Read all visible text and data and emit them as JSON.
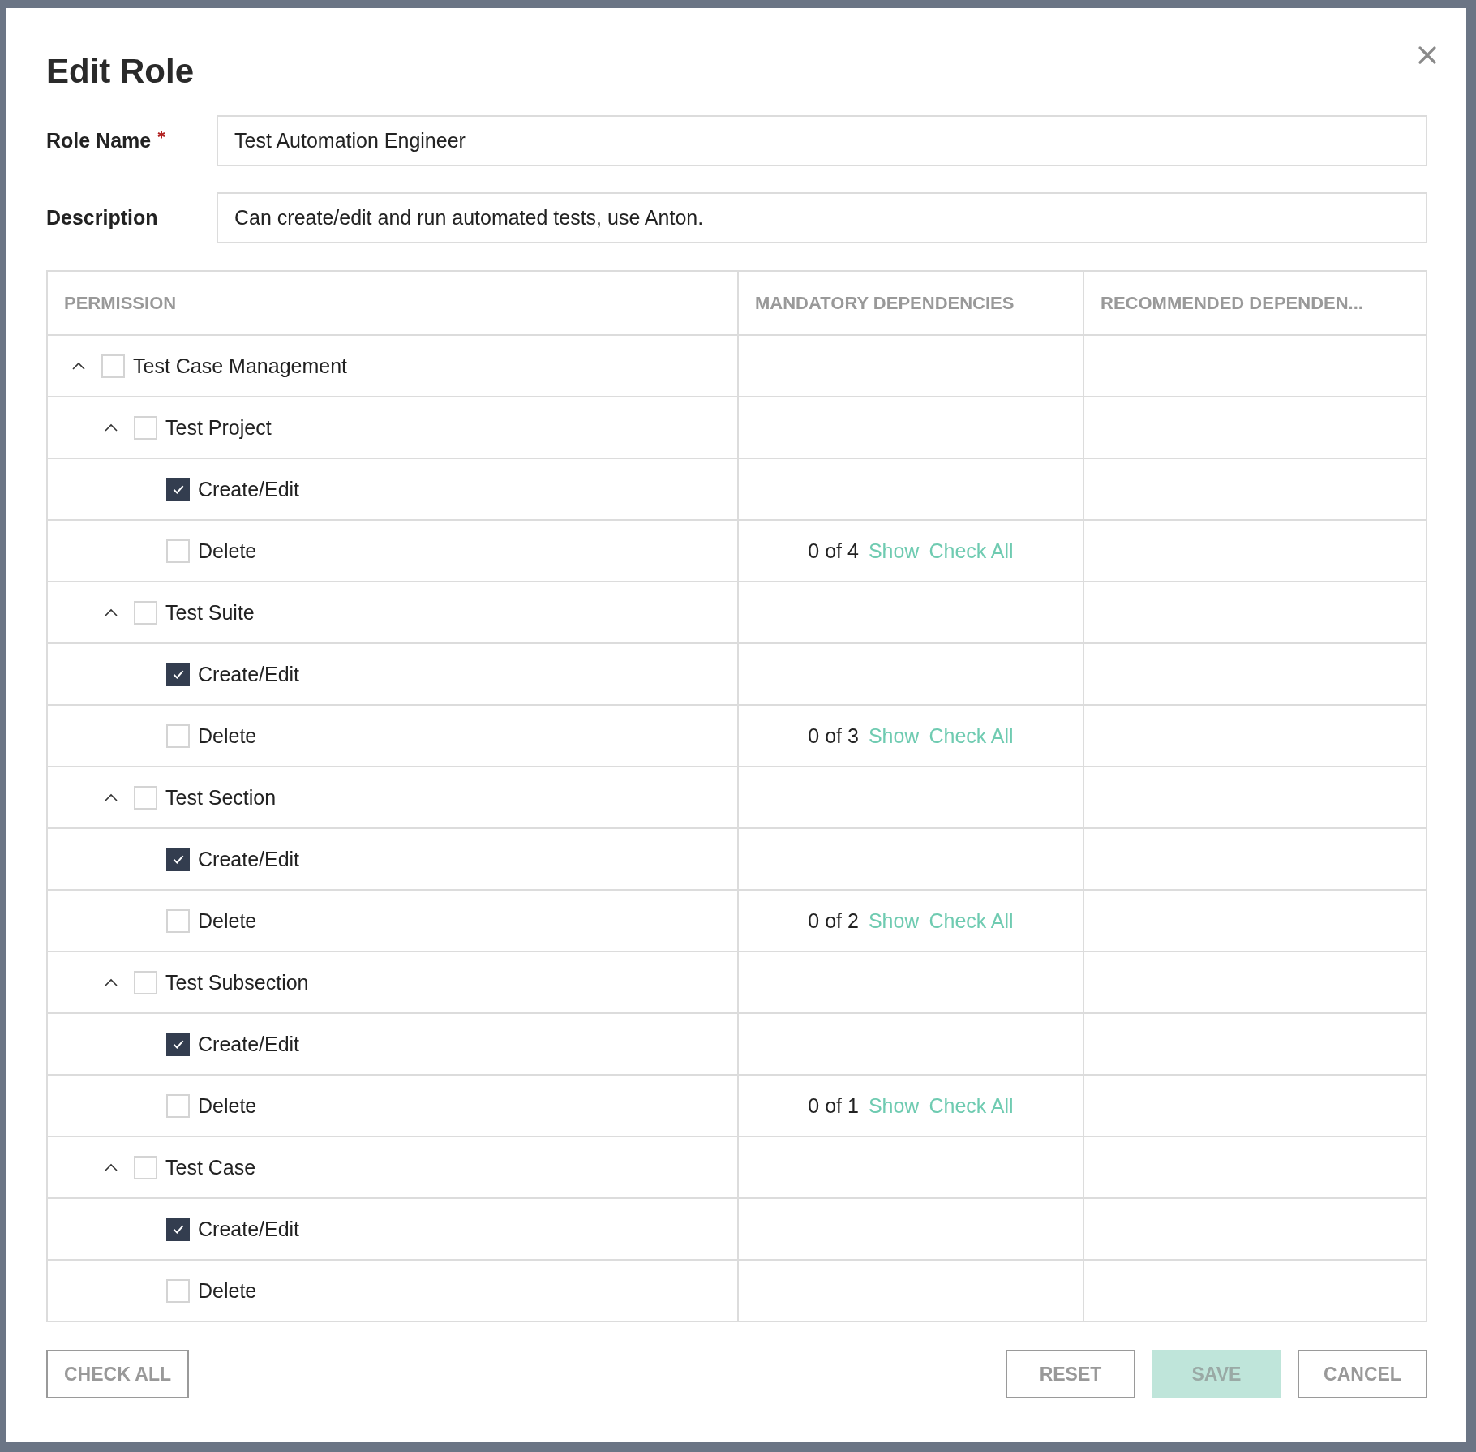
{
  "dialog": {
    "title": "Edit Role"
  },
  "fields": [
    {
      "label": "Role Name",
      "required": true,
      "value": "Test Automation Engineer"
    },
    {
      "label": "Description",
      "required": false,
      "value": "Can create/edit and run automated tests, use Anton."
    }
  ],
  "table": {
    "columns": [
      "PERMISSION",
      "MANDATORY DEPENDENCIES",
      "RECOMMENDED DEPENDEN..."
    ],
    "tree": [
      {
        "label": "Test Case Management",
        "checked": false,
        "expanded": true,
        "children": [
          {
            "label": "Test Project",
            "checked": false,
            "expanded": true,
            "children": [
              {
                "label": "Create/Edit",
                "checked": true
              },
              {
                "label": "Delete",
                "checked": false,
                "dependencies": {
                  "count": "0 of 4",
                  "show": "Show",
                  "check_all": "Check All"
                }
              }
            ]
          },
          {
            "label": "Test Suite",
            "checked": false,
            "expanded": true,
            "children": [
              {
                "label": "Create/Edit",
                "checked": true
              },
              {
                "label": "Delete",
                "checked": false,
                "dependencies": {
                  "count": "0 of 3",
                  "show": "Show",
                  "check_all": "Check All"
                }
              }
            ]
          },
          {
            "label": "Test Section",
            "checked": false,
            "expanded": true,
            "children": [
              {
                "label": "Create/Edit",
                "checked": true
              },
              {
                "label": "Delete",
                "checked": false,
                "dependencies": {
                  "count": "0 of 2",
                  "show": "Show",
                  "check_all": "Check All"
                }
              }
            ]
          },
          {
            "label": "Test Subsection",
            "checked": false,
            "expanded": true,
            "children": [
              {
                "label": "Create/Edit",
                "checked": true
              },
              {
                "label": "Delete",
                "checked": false,
                "dependencies": {
                  "count": "0 of 1",
                  "show": "Show",
                  "check_all": "Check All"
                }
              }
            ]
          },
          {
            "label": "Test Case",
            "checked": false,
            "expanded": true,
            "children": [
              {
                "label": "Create/Edit",
                "checked": true
              },
              {
                "label": "Delete",
                "checked": false
              }
            ]
          }
        ]
      }
    ]
  },
  "buttons_left": [
    {
      "label": "CHECK ALL",
      "kind": "outline",
      "disabled": false
    }
  ],
  "buttons_right": [
    {
      "label": "RESET",
      "kind": "outline",
      "disabled": false
    },
    {
      "label": "SAVE",
      "kind": "primary",
      "disabled": true
    },
    {
      "label": "CANCEL",
      "kind": "outline",
      "disabled": false
    }
  ]
}
